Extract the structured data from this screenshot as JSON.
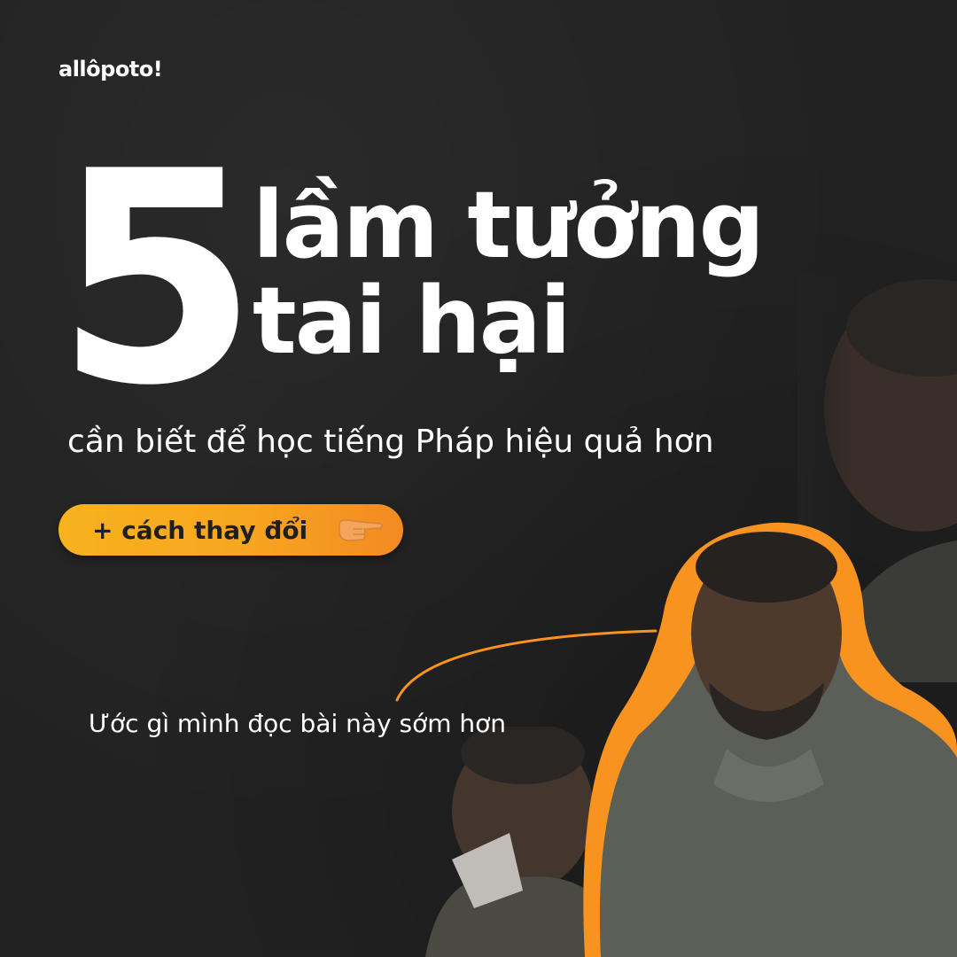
{
  "brand": {
    "logo_text": "allôpoto!"
  },
  "headline": {
    "number": "5",
    "line1": "lầm tưởng",
    "line2": "tai hại"
  },
  "subtitle": "cần biết để học tiếng Pháp hiệu quả hơn",
  "cta": {
    "label": "+ cách thay đổi",
    "icon": "pointing-hand-icon"
  },
  "caption": "Ước gì mình đọc bài này sớm hơn",
  "colors": {
    "background": "#222222",
    "accent_orange": "#f7931e",
    "pill_yellow": "#f7b21d",
    "text": "#ffffff"
  }
}
